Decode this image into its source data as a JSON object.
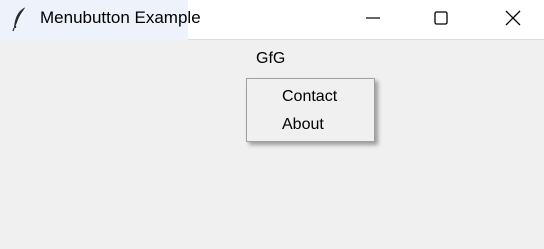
{
  "window": {
    "title": "Menubutton Example",
    "icon": "feather-icon",
    "controls": {
      "minimize_icon": "minimize-icon",
      "maximize_icon": "maximize-icon",
      "close_icon": "close-icon"
    }
  },
  "menubutton": {
    "label": "GfG"
  },
  "menu": {
    "items": [
      {
        "label": "Contact"
      },
      {
        "label": "About"
      }
    ]
  },
  "colors": {
    "background": "#f0f0f0",
    "titlebar": "#ffffff",
    "menu_border": "#a0a0a0"
  }
}
